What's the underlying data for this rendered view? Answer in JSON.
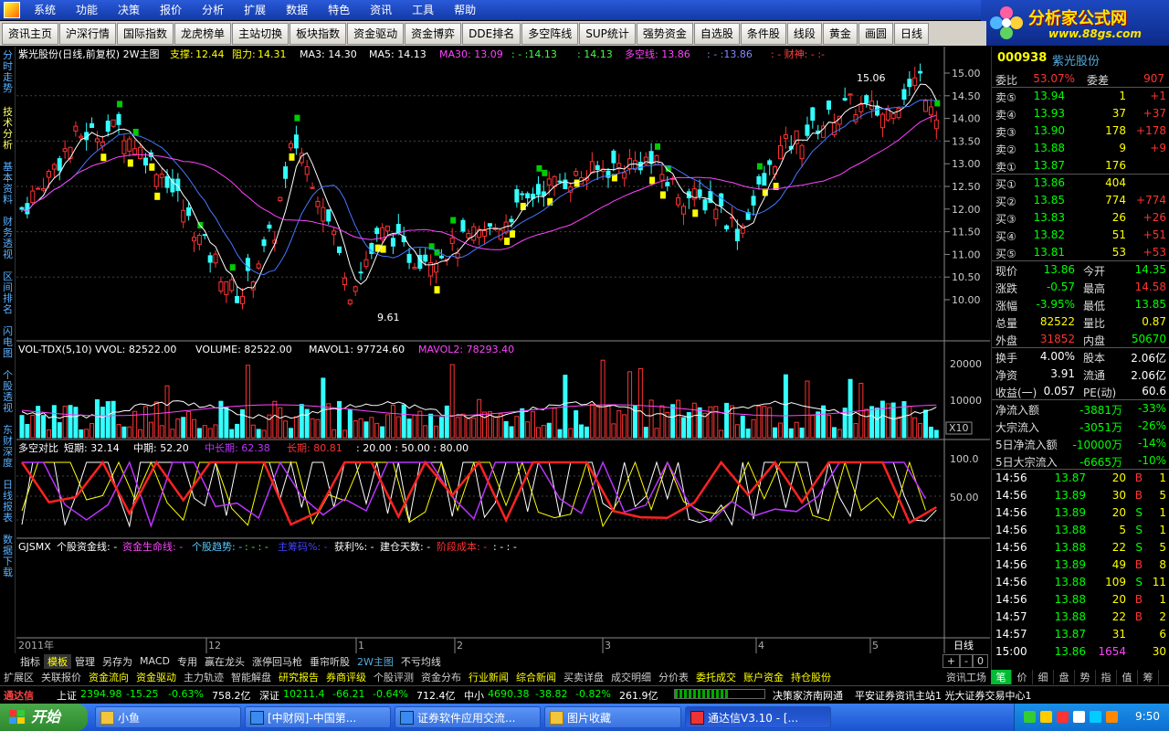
{
  "menu": [
    "系统",
    "功能",
    "决策",
    "报价",
    "分析",
    "扩展",
    "数据",
    "特色",
    "资讯",
    "工具",
    "帮助"
  ],
  "brand": {
    "title": "分析家公式网",
    "url": "www.88gs.com"
  },
  "toolbar": [
    "资讯主页",
    "沪深行情",
    "国际指数",
    "龙虎榜单",
    "主站切换",
    "板块指数",
    "资金驱动",
    "资金博弈",
    "DDE排名",
    "多空阵线",
    "SUP统计",
    "强势资金",
    "自选股",
    "条件股",
    "线段",
    "黄金",
    "画圆",
    "日线"
  ],
  "left_tabs": [
    "分时走势",
    "技术分析",
    "基本资料",
    "财务透视",
    "区间排名",
    "闪电图",
    "个股透视",
    "东财深度",
    "日线报表",
    "数据下载"
  ],
  "main_header": {
    "stock": "紫光股份(日线,前复权) 2W主图",
    "support_label": "支撑:",
    "support": "12.44",
    "resist_label": "阻力:",
    "resist": "14.31",
    "ma3": "MA3: 14.30",
    "ma5": "MA5: 14.13",
    "ma30": "MA30: 13.09",
    "dash1": ": - :14.13",
    "dash2": ": 14.13",
    "duokong": "多空线: 13.86",
    "dash3": ": - :13.86",
    "caishen": ": - 财神: - :-"
  },
  "price_axis": [
    "15.00",
    "14.50",
    "14.00",
    "13.50",
    "13.00",
    "12.50",
    "12.00",
    "11.50",
    "11.00",
    "10.50",
    "10.00"
  ],
  "annotations": {
    "high": "15.06",
    "low": "9.61"
  },
  "vol_header": {
    "name": "VOL-TDX(5,10)",
    "vvol": "VVOL: 82522.00",
    "volume": "VOLUME: 82522.00",
    "mavol1": "MAVOL1: 97724.60",
    "mavol2": "MAVOL2: 78293.40"
  },
  "vol_axis": [
    "20000",
    "10000"
  ],
  "vol_unit": "X10",
  "dk_header": {
    "name": "多空对比",
    "short": "短期: 32.14",
    "mid": "中期: 52.20",
    "midlong": "中长期: 62.38",
    "long": "长期: 80.81",
    "levels": ": 20.00 : 50.00 : 80.00"
  },
  "dk_axis": [
    "100.0",
    "50.00"
  ],
  "gj_header": {
    "name": "GJSMX",
    "a": "个股资金线: -",
    "b": "资金生命线: -",
    "c": "个股趋势: -",
    "d": ": - : -",
    "e": "主筹码%: -",
    "f": "获利%: -",
    "g": "建仓天数: -",
    "h": "阶段成本: -",
    "i": ": - : -"
  },
  "time_axis": {
    "year": "2011年",
    "labels": [
      "12",
      "1",
      "2",
      "3",
      "4",
      "5"
    ],
    "period": "日线",
    "controls": [
      "+",
      "-",
      "0"
    ]
  },
  "bottom_tabs1": [
    "指标",
    "模板",
    "管理",
    "另存为",
    "MACD",
    "专用",
    "赢在龙头",
    "涨停回马枪",
    "垂帘听股",
    "2W主图",
    "不亏均线"
  ],
  "bottom_tabs2": [
    "扩展区",
    "关联报价",
    "资金流向",
    "资金驱动",
    "主力轨迹",
    "智能解盘",
    "研究报告",
    "券商评级",
    "个股评测",
    "资金分布",
    "行业新闻",
    "综合新闻",
    "买卖详盘",
    "成交明细",
    "分价表",
    "委托成交",
    "账户资金",
    "持仓股份",
    "资讯工场"
  ],
  "side": {
    "code": "000938",
    "name": "紫光股份",
    "weibi_label": "委比",
    "weibi": "53.07%",
    "weicha_label": "委差",
    "weicha": "907",
    "asks": [
      {
        "label": "卖⑤",
        "price": "13.94",
        "vol": "1",
        "chg": "+1"
      },
      {
        "label": "卖④",
        "price": "13.93",
        "vol": "37",
        "chg": "+37"
      },
      {
        "label": "卖③",
        "price": "13.90",
        "vol": "178",
        "chg": "+178"
      },
      {
        "label": "卖②",
        "price": "13.88",
        "vol": "9",
        "chg": "+9"
      },
      {
        "label": "卖①",
        "price": "13.87",
        "vol": "176",
        "chg": ""
      }
    ],
    "bids": [
      {
        "label": "买①",
        "price": "13.86",
        "vol": "404",
        "chg": ""
      },
      {
        "label": "买②",
        "price": "13.85",
        "vol": "774",
        "chg": "+774"
      },
      {
        "label": "买③",
        "price": "13.83",
        "vol": "26",
        "chg": "+26"
      },
      {
        "label": "买④",
        "price": "13.82",
        "vol": "51",
        "chg": "+51"
      },
      {
        "label": "买⑤",
        "price": "13.81",
        "vol": "53",
        "chg": "+53"
      }
    ],
    "stats": [
      {
        "l1": "现价",
        "v1": "13.86",
        "c1": "#0f0",
        "l2": "今开",
        "v2": "14.35",
        "c2": "#0f0"
      },
      {
        "l1": "涨跌",
        "v1": "-0.57",
        "c1": "#0f0",
        "l2": "最高",
        "v2": "14.58",
        "c2": "#f33"
      },
      {
        "l1": "涨幅",
        "v1": "-3.95%",
        "c1": "#0f0",
        "l2": "最低",
        "v2": "13.85",
        "c2": "#0f0"
      },
      {
        "l1": "总量",
        "v1": "82522",
        "c1": "#ff0",
        "l2": "量比",
        "v2": "0.87",
        "c2": "#ff0"
      },
      {
        "l1": "外盘",
        "v1": "31852",
        "c1": "#f33",
        "l2": "内盘",
        "v2": "50670",
        "c2": "#0f0"
      },
      {
        "l1": "换手",
        "v1": "4.00%",
        "c1": "#fff",
        "l2": "股本",
        "v2": "2.06亿",
        "c2": "#fff"
      },
      {
        "l1": "净资",
        "v1": "3.91",
        "c1": "#fff",
        "l2": "流通",
        "v2": "2.06亿",
        "c2": "#fff"
      },
      {
        "l1": "收益(一)",
        "v1": "0.057",
        "c1": "#fff",
        "l2": "PE(动)",
        "v2": "60.6",
        "c2": "#fff"
      }
    ],
    "flows": [
      {
        "label": "净流入额",
        "value": "-3881万",
        "pct": "-33%"
      },
      {
        "label": "大宗流入",
        "value": "-3051万",
        "pct": "-26%"
      },
      {
        "label": "5日净流入额",
        "value": "-10000万",
        "pct": "-14%"
      },
      {
        "label": "5日大宗流入",
        "value": "-6665万",
        "pct": "-10%"
      }
    ],
    "ticks": [
      {
        "time": "14:56",
        "price": "13.87",
        "vol": "20",
        "bs": "B",
        "n": "1"
      },
      {
        "time": "14:56",
        "price": "13.89",
        "vol": "30",
        "bs": "B",
        "n": "5"
      },
      {
        "time": "14:56",
        "price": "13.89",
        "vol": "20",
        "bs": "S",
        "n": "1"
      },
      {
        "time": "14:56",
        "price": "13.88",
        "vol": "5",
        "bs": "S",
        "n": "1"
      },
      {
        "time": "14:56",
        "price": "13.88",
        "vol": "22",
        "bs": "S",
        "n": "5"
      },
      {
        "time": "14:56",
        "price": "13.89",
        "vol": "49",
        "bs": "B",
        "n": "8"
      },
      {
        "time": "14:56",
        "price": "13.88",
        "vol": "109",
        "bs": "S",
        "n": "11"
      },
      {
        "time": "14:56",
        "price": "13.88",
        "vol": "20",
        "bs": "B",
        "n": "1"
      },
      {
        "time": "14:57",
        "price": "13.88",
        "vol": "22",
        "bs": "B",
        "n": "2"
      },
      {
        "time": "14:57",
        "price": "13.87",
        "vol": "31",
        "bs": "",
        "n": "6"
      },
      {
        "time": "15:00",
        "price": "13.86",
        "vol": "1654",
        "bs": "",
        "n": "30"
      }
    ],
    "tabs": [
      "笔",
      "价",
      "细",
      "盘",
      "势",
      "指",
      "值",
      "筹"
    ]
  },
  "status": {
    "app": "通达信",
    "sh_label": "上证",
    "sh": "2394.98",
    "sh_chg": "-15.25",
    "sh_pct": "-0.63%",
    "sh_amt": "758.2亿",
    "sz_label": "深证",
    "sz": "10211.4",
    "sz_chg": "-66.21",
    "sz_pct": "-0.64%",
    "sz_amt": "712.4亿",
    "zx_label": "中小",
    "zx": "4690.38",
    "zx_chg": "-38.82",
    "zx_pct": "-0.82%",
    "zx_amt": "261.9亿",
    "server": "决策家济南网通",
    "ticker": "平安证券资讯主站1  光大证券交易中心1"
  },
  "taskbar": {
    "start": "开始",
    "items": [
      "小鱼",
      "[中财网]-中国第...",
      "证券软件应用交流...",
      "图片收藏",
      "通达信V3.10 - [..."
    ],
    "clock": "9:50"
  },
  "colors": {
    "up": "#ff3333",
    "down": "#33ffff",
    "ma_white": "#ffffff",
    "ma30": "#ff44ff",
    "duokong": "#4477ff"
  }
}
